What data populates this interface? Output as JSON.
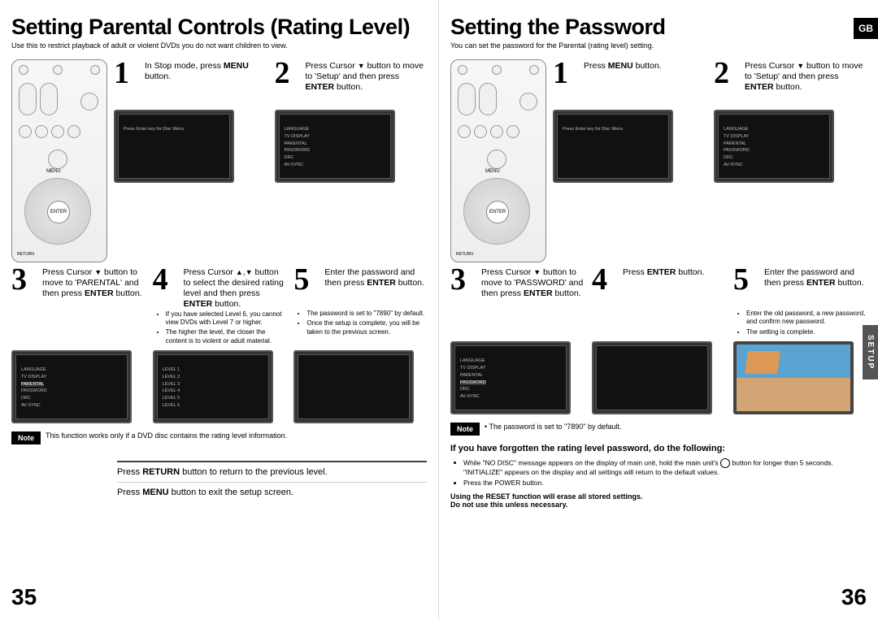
{
  "left": {
    "title": "Setting Parental Controls (Rating Level)",
    "subtitle": "Use this to restrict playback of adult or violent DVDs you do not want children to view.",
    "step1": "In Stop mode, press MENU button.",
    "step2": "Press Cursor ▼ button to move to 'Setup' and then press ENTER button.",
    "step3": "Press Cursor ▼ button to move to 'PARENTAL' and then press ENTER button.",
    "step4": "Press Cursor ▲,▼ button to select the desired rating level and then press ENTER button.",
    "step4_bullet1": "If you have selected Level 6, you cannot view DVDs with Level 7 or higher.",
    "step4_bullet2": "The higher the level, the closer the content is to violent or adult material.",
    "step5": "Enter the password and then press ENTER button.",
    "step5_bullet1": "The password is set to \"7890\" by default.",
    "step5_bullet2": "Once the setup is complete, you will be taken to the previous screen.",
    "note": "This function works only if a DVD disc contains the rating level information.",
    "footer1a": "Press ",
    "footer1b": "RETURN",
    "footer1c": " button to return to the previous level.",
    "footer2a": "Press ",
    "footer2b": "MENU",
    "footer2c": " button to exit the setup screen.",
    "pagenum": "35"
  },
  "right": {
    "title": "Setting the Password",
    "subtitle": "You can set the password for the Parental (rating level) setting.",
    "gb": "GB",
    "step1": "Press MENU button.",
    "step2": "Press Cursor ▼ button to move to 'Setup' and then press ENTER button.",
    "step3": "Press Cursor ▼ button to move to 'PASSWORD' and then press ENTER button.",
    "step4": "Press ENTER button.",
    "step5": "Enter the password and then press ENTER button.",
    "step5_bullet1": "Enter the old password, a new password, and confirm new password.",
    "step5_bullet2": "The setting is complete.",
    "note": "The password is set to \"7890\" by default.",
    "forgot_heading": "If you have forgotten the rating level password, do the following:",
    "forgot_b1a": "While \"NO DISC\" message appears on the display of main unit, hold the main unit's ",
    "forgot_b1b": " button for longer than 5 seconds. \"INITIALIZE\" appears on the display and all settings will return to the default values.",
    "forgot_b2": "Press the POWER button.",
    "warn1": "Using the RESET function will erase all stored settings.",
    "warn2": "Do not use this unless necessary.",
    "sidetab": "SETUP",
    "pagenum": "36"
  },
  "note_label": "Note",
  "tv_menu": {
    "items": [
      "LANGUAGE",
      "TV DISPLAY",
      "PARENTAL",
      "PASSWORD",
      "DRC",
      "AV-SYNC"
    ],
    "levels": [
      "LEVEL 1",
      "LEVEL 2",
      "LEVEL 3",
      "LEVEL 4",
      "LEVEL 5",
      "LEVEL 6"
    ],
    "prompt": "Press Enter key for Disc Menu"
  }
}
